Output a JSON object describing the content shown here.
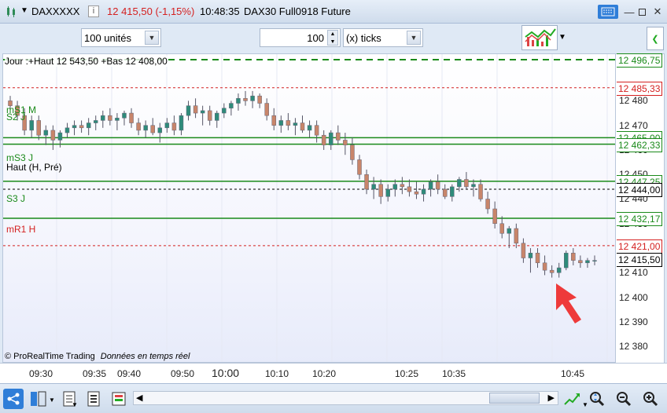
{
  "window": {
    "symbol": "DAXXXXX",
    "price_change": "12 415,50 (-1,15%)",
    "time": "10:48:35",
    "instrument": "DAX30 Full0918 Future",
    "info_icon": "i"
  },
  "toolbar": {
    "units": "100 unités",
    "ticks_value": "100",
    "ticks_unit": "(x) ticks"
  },
  "chart": {
    "header_text": "Jour :+Haut 12 543,50 +Bas 12 408,00",
    "watermark": "© ProRealTime Trading",
    "watermark_suffix": "Données en temps réel",
    "level_labels": [
      {
        "text": "mS1 M",
        "color": "#1a8a1a"
      },
      {
        "text": "S2 J",
        "color": "#1a8a1a"
      },
      {
        "text": "mS3 J",
        "color": "#1a8a1a"
      },
      {
        "text": "Haut (H, Pré)",
        "color": "#000000"
      },
      {
        "text": "S3 J",
        "color": "#1a8a1a"
      },
      {
        "text": "mR1 H",
        "color": "#d42020"
      }
    ]
  },
  "price_axis": {
    "ticks": [
      "12 480",
      "12 470",
      "12 460",
      "12 450",
      "12 440",
      "12 430",
      "12 420",
      "12 410",
      "12 400",
      "12 390",
      "12 380"
    ],
    "tags": [
      {
        "text": "12 496,75",
        "color": "#1a8a1a",
        "bg": "#ffffff"
      },
      {
        "text": "12 485,33",
        "color": "#d42020",
        "bg": "#ffffff"
      },
      {
        "text": "12 465,00",
        "color": "#1a8a1a",
        "bg": "#ffffff"
      },
      {
        "text": "12 462,33",
        "color": "#1a8a1a",
        "bg": "#ffffff"
      },
      {
        "text": "12 447,25",
        "color": "#1a8a1a",
        "bg": "#ffffff"
      },
      {
        "text": "12 444,00",
        "color": "#000000",
        "bg": "#ffffff"
      },
      {
        "text": "12 432,17",
        "color": "#1a8a1a",
        "bg": "#ffffff"
      },
      {
        "text": "12 421,00",
        "color": "#d42020",
        "bg": "#ffffff"
      },
      {
        "text": "12 415,50",
        "color": "#000000",
        "bg": "#ffffff"
      }
    ]
  },
  "time_axis": {
    "ticks": [
      "09:30",
      "09:35",
      "09:40",
      "09:50",
      "10:00",
      "10:10",
      "10:20",
      "10:25",
      "10:35",
      "10:45"
    ]
  },
  "icons": {
    "up_color": "#2e8b7a",
    "down_color": "#c8856a",
    "accent_red": "#e83030"
  },
  "chart_data": {
    "type": "candlestick",
    "ylim": [
      12373,
      12499
    ],
    "levels": [
      {
        "name": "mS1 M",
        "value": 12496.75,
        "color": "#1a8a1a",
        "style": "dashed"
      },
      {
        "name": "mR1",
        "value": 12485.33,
        "color": "#d42020",
        "style": "dashed"
      },
      {
        "name": "mS1 M",
        "value": 12465.0,
        "color": "#1a8a1a",
        "style": "solid"
      },
      {
        "name": "S2 J",
        "value": 12462.33,
        "color": "#1a8a1a",
        "style": "solid"
      },
      {
        "name": "mS3 J",
        "value": 12447.25,
        "color": "#1a8a1a",
        "style": "solid"
      },
      {
        "name": "Haut (H, Pré)",
        "value": 12444.0,
        "color": "#000000",
        "style": "dashed"
      },
      {
        "name": "S3 J",
        "value": 12432.17,
        "color": "#1a8a1a",
        "style": "solid"
      },
      {
        "name": "mR1 H",
        "value": 12421.0,
        "color": "#d42020",
        "style": "dashed"
      }
    ],
    "candles": [
      [
        12480,
        12482,
        12476,
        12478
      ],
      [
        12478,
        12480,
        12472,
        12474
      ],
      [
        12474,
        12477,
        12466,
        12468
      ],
      [
        12468,
        12474,
        12465,
        12472
      ],
      [
        12472,
        12474,
        12464,
        12466
      ],
      [
        12466,
        12470,
        12462,
        12468
      ],
      [
        12468,
        12470,
        12460,
        12464
      ],
      [
        12464,
        12468,
        12461,
        12467
      ],
      [
        12467,
        12471,
        12465,
        12469
      ],
      [
        12469,
        12472,
        12466,
        12470
      ],
      [
        12470,
        12472,
        12467,
        12469
      ],
      [
        12469,
        12473,
        12466,
        12471
      ],
      [
        12471,
        12474,
        12468,
        12472
      ],
      [
        12472,
        12476,
        12469,
        12474
      ],
      [
        12474,
        12477,
        12470,
        12472
      ],
      [
        12472,
        12475,
        12468,
        12473
      ],
      [
        12473,
        12476,
        12470,
        12475
      ],
      [
        12475,
        12477,
        12469,
        12471
      ],
      [
        12471,
        12473,
        12466,
        12468
      ],
      [
        12468,
        12472,
        12465,
        12470
      ],
      [
        12470,
        12473,
        12466,
        12467
      ],
      [
        12467,
        12471,
        12463,
        12469
      ],
      [
        12469,
        12473,
        12467,
        12471
      ],
      [
        12471,
        12474,
        12466,
        12468
      ],
      [
        12468,
        12475,
        12466,
        12474
      ],
      [
        12474,
        12480,
        12472,
        12478
      ],
      [
        12478,
        12481,
        12473,
        12475
      ],
      [
        12475,
        12478,
        12470,
        12476
      ],
      [
        12476,
        12478,
        12470,
        12472
      ],
      [
        12472,
        12476,
        12469,
        12475
      ],
      [
        12475,
        12479,
        12473,
        12477
      ],
      [
        12477,
        12480,
        12474,
        12479
      ],
      [
        12479,
        12483,
        12476,
        12481
      ],
      [
        12481,
        12484,
        12478,
        12480
      ],
      [
        12480,
        12484,
        12477,
        12482
      ],
      [
        12482,
        12483,
        12477,
        12479
      ],
      [
        12479,
        12481,
        12472,
        12474
      ],
      [
        12474,
        12477,
        12468,
        12470
      ],
      [
        12470,
        12474,
        12467,
        12472
      ],
      [
        12472,
        12475,
        12468,
        12470
      ],
      [
        12470,
        12473,
        12466,
        12471
      ],
      [
        12471,
        12474,
        12467,
        12468
      ],
      [
        12468,
        12472,
        12465,
        12470
      ],
      [
        12470,
        12472,
        12463,
        12466
      ],
      [
        12466,
        12468,
        12460,
        12462
      ],
      [
        12462,
        12468,
        12460,
        12467
      ],
      [
        12467,
        12470,
        12462,
        12464
      ],
      [
        12464,
        12467,
        12458,
        12462
      ],
      [
        12462,
        12465,
        12454,
        12456
      ],
      [
        12456,
        12458,
        12448,
        12450
      ],
      [
        12450,
        12452,
        12442,
        12444
      ],
      [
        12444,
        12449,
        12440,
        12446
      ],
      [
        12446,
        12448,
        12438,
        12441
      ],
      [
        12441,
        12446,
        12439,
        12444
      ],
      [
        12444,
        12448,
        12441,
        12446
      ],
      [
        12446,
        12449,
        12442,
        12445
      ],
      [
        12445,
        12448,
        12441,
        12443
      ],
      [
        12443,
        12447,
        12440,
        12442
      ],
      [
        12442,
        12446,
        12439,
        12444
      ],
      [
        12444,
        12448,
        12441,
        12447
      ],
      [
        12447,
        12450,
        12442,
        12444
      ],
      [
        12444,
        12446,
        12440,
        12441
      ],
      [
        12441,
        12446,
        12439,
        12445
      ],
      [
        12445,
        12449,
        12443,
        12448
      ],
      [
        12448,
        12451,
        12444,
        12445
      ],
      [
        12445,
        12448,
        12441,
        12446
      ],
      [
        12446,
        12448,
        12439,
        12440
      ],
      [
        12440,
        12443,
        12434,
        12436
      ],
      [
        12436,
        12439,
        12428,
        12430
      ],
      [
        12430,
        12433,
        12424,
        12426
      ],
      [
        12426,
        12429,
        12420,
        12428
      ],
      [
        12428,
        12430,
        12420,
        12422
      ],
      [
        12422,
        12424,
        12414,
        12416
      ],
      [
        12416,
        12420,
        12410,
        12418
      ],
      [
        12418,
        12420,
        12412,
        12414
      ],
      [
        12414,
        12417,
        12409,
        12411
      ],
      [
        12411,
        12413,
        12408,
        12410
      ],
      [
        12410,
        12414,
        12408,
        12412
      ],
      [
        12412,
        12419,
        12411,
        12418
      ],
      [
        12418,
        12420,
        12413,
        12415
      ],
      [
        12415,
        12417,
        12412,
        12414
      ],
      [
        12414,
        12416,
        12412,
        12415
      ],
      [
        12415,
        12417,
        12413,
        12415
      ]
    ]
  }
}
